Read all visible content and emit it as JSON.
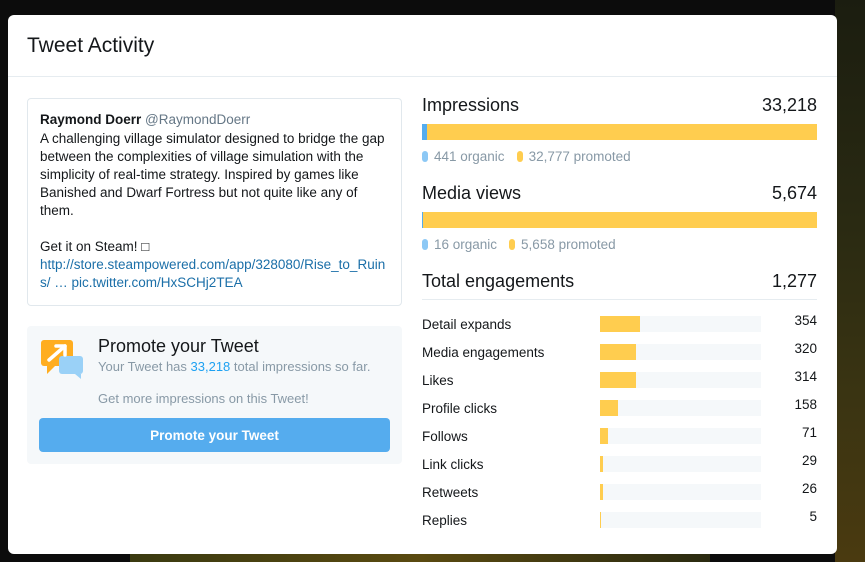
{
  "modal": {
    "title": "Tweet Activity"
  },
  "tweet": {
    "author_name": "Raymond Doerr",
    "author_handle": "@RaymondDoerr",
    "text": "A challenging village simulator designed to bridge the gap between the complexities of village simulation with the simplicity of real-time strategy. Inspired by games like  Banished and Dwarf Fortress but not quite like any of them.\n\nGet it on Steam! □",
    "link_url": "http://store.steampowered.com/app/328080/Rise_to_Ruins/ …",
    "link_pic": "pic.twitter.com/HxSCHj2TEA"
  },
  "promo": {
    "icon": "promote-tweet-icon",
    "title": "Promote your Tweet",
    "text_before": "Your Tweet has ",
    "impressions": "33,218",
    "text_after": " total impressions so far.",
    "text_line2": "Get more impressions on this Tweet!",
    "button_label": "Promote your Tweet"
  },
  "impressions": {
    "label": "Impressions",
    "value": "33,218",
    "organic_label": "441 organic",
    "promoted_label": "32,777 promoted",
    "organic_fraction": 0.0133
  },
  "media_views": {
    "label": "Media views",
    "value": "5,674",
    "organic_label": "16 organic",
    "promoted_label": "5,658 promoted",
    "organic_fraction": 0.0028
  },
  "engagements": {
    "label": "Total engagements",
    "value": "1,277",
    "max": 1277,
    "items": [
      {
        "label": "Detail expands",
        "value": 354
      },
      {
        "label": "Media engagements",
        "value": 320
      },
      {
        "label": "Likes",
        "value": 314
      },
      {
        "label": "Profile clicks",
        "value": 158
      },
      {
        "label": "Follows",
        "value": 71
      },
      {
        "label": "Link clicks",
        "value": 29
      },
      {
        "label": "Retweets",
        "value": 26
      },
      {
        "label": "Replies",
        "value": 5
      }
    ]
  },
  "colors": {
    "organic": "#55acee",
    "promoted": "#ffcd4f",
    "link": "#1b6fa8",
    "button": "#55acee"
  }
}
